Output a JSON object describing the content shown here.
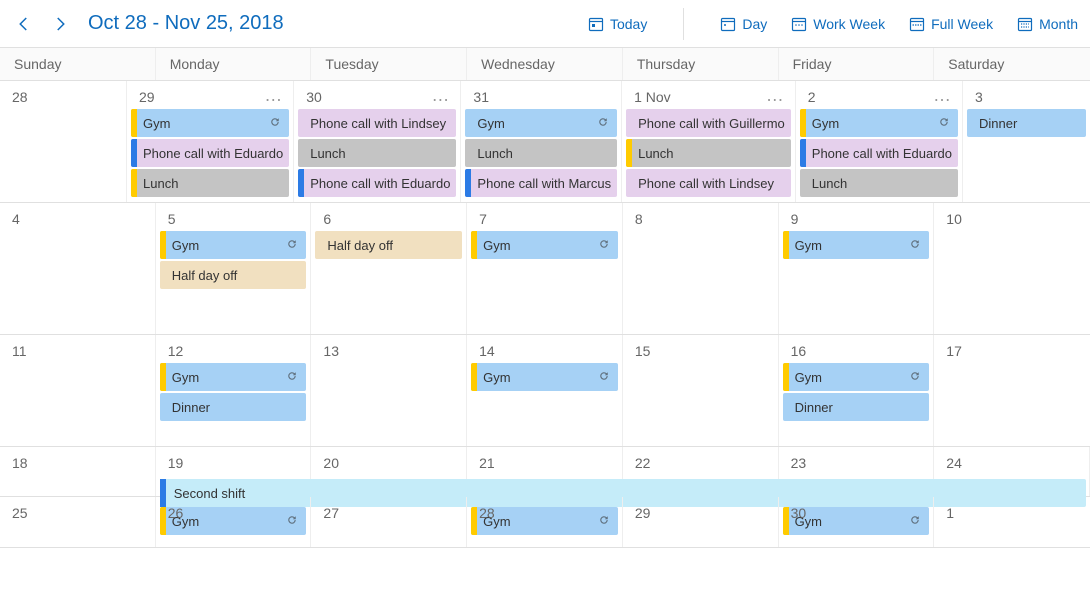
{
  "header": {
    "title": "Oct 28 - Nov 25, 2018",
    "today": "Today",
    "views": {
      "day": "Day",
      "workweek": "Work Week",
      "fullweek": "Full Week",
      "month": "Month"
    }
  },
  "dayNames": [
    "Sunday",
    "Monday",
    "Tuesday",
    "Wednesday",
    "Thursday",
    "Friday",
    "Saturday"
  ],
  "weeks": [
    {
      "days": [
        {
          "num": "28",
          "more": false,
          "events": []
        },
        {
          "num": "29",
          "more": true,
          "events": [
            {
              "label": "Gym",
              "bg": "bg-blue",
              "stripe": "st-yellow",
              "recur": true
            },
            {
              "label": "Phone call with Eduardo",
              "bg": "bg-purple",
              "stripe": "st-blue",
              "recur": false
            },
            {
              "label": "Lunch",
              "bg": "bg-gray",
              "stripe": "st-yellow",
              "recur": false
            }
          ]
        },
        {
          "num": "30",
          "more": true,
          "events": [
            {
              "label": "Phone call with Lindsey",
              "bg": "bg-purple",
              "stripe": "st-none",
              "recur": false
            },
            {
              "label": "Lunch",
              "bg": "bg-gray",
              "stripe": "st-none",
              "recur": false
            },
            {
              "label": "Phone call with Eduardo",
              "bg": "bg-purple",
              "stripe": "st-blue",
              "recur": false
            }
          ]
        },
        {
          "num": "31",
          "more": false,
          "events": [
            {
              "label": "Gym",
              "bg": "bg-blue",
              "stripe": "st-none",
              "recur": true
            },
            {
              "label": "Lunch",
              "bg": "bg-gray",
              "stripe": "st-none",
              "recur": false
            },
            {
              "label": "Phone call with Marcus",
              "bg": "bg-purple",
              "stripe": "st-blue",
              "recur": false
            }
          ]
        },
        {
          "num": "1 Nov",
          "more": true,
          "events": [
            {
              "label": "Phone call with Guillermo",
              "bg": "bg-purple",
              "stripe": "st-none",
              "recur": false
            },
            {
              "label": "Lunch",
              "bg": "bg-gray",
              "stripe": "st-yellow",
              "recur": false
            },
            {
              "label": "Phone call with Lindsey",
              "bg": "bg-purple",
              "stripe": "st-none",
              "recur": false
            }
          ]
        },
        {
          "num": "2",
          "more": true,
          "events": [
            {
              "label": "Gym",
              "bg": "bg-blue",
              "stripe": "st-yellow",
              "recur": true
            },
            {
              "label": "Phone call with Eduardo",
              "bg": "bg-purple",
              "stripe": "st-blue",
              "recur": false
            },
            {
              "label": "Lunch",
              "bg": "bg-gray",
              "stripe": "st-none",
              "recur": false
            }
          ]
        },
        {
          "num": "3",
          "more": false,
          "events": [
            {
              "label": "Dinner",
              "bg": "bg-blue",
              "stripe": "st-none",
              "recur": false
            }
          ]
        }
      ]
    },
    {
      "days": [
        {
          "num": "4",
          "more": false,
          "events": []
        },
        {
          "num": "5",
          "more": false,
          "events": [
            {
              "label": "Gym",
              "bg": "bg-blue",
              "stripe": "st-yellow",
              "recur": true
            },
            {
              "label": "Half day off",
              "bg": "bg-tan",
              "stripe": "st-none",
              "recur": false
            }
          ]
        },
        {
          "num": "6",
          "more": false,
          "events": [
            {
              "label": "Half day off",
              "bg": "bg-tan",
              "stripe": "st-none",
              "recur": false
            }
          ]
        },
        {
          "num": "7",
          "more": false,
          "events": [
            {
              "label": "Gym",
              "bg": "bg-blue",
              "stripe": "st-yellow",
              "recur": true
            }
          ]
        },
        {
          "num": "8",
          "more": false,
          "events": []
        },
        {
          "num": "9",
          "more": false,
          "events": [
            {
              "label": "Gym",
              "bg": "bg-blue",
              "stripe": "st-yellow",
              "recur": true
            }
          ]
        },
        {
          "num": "10",
          "more": false,
          "events": []
        }
      ]
    },
    {
      "days": [
        {
          "num": "11",
          "more": false,
          "events": []
        },
        {
          "num": "12",
          "more": false,
          "events": [
            {
              "label": "Gym",
              "bg": "bg-blue",
              "stripe": "st-yellow",
              "recur": true
            },
            {
              "label": "Dinner",
              "bg": "bg-blue",
              "stripe": "st-none",
              "recur": false
            }
          ]
        },
        {
          "num": "13",
          "more": false,
          "events": []
        },
        {
          "num": "14",
          "more": false,
          "events": [
            {
              "label": "Gym",
              "bg": "bg-blue",
              "stripe": "st-yellow",
              "recur": true
            }
          ]
        },
        {
          "num": "15",
          "more": false,
          "events": []
        },
        {
          "num": "16",
          "more": false,
          "events": [
            {
              "label": "Gym",
              "bg": "bg-blue",
              "stripe": "st-yellow",
              "recur": true
            },
            {
              "label": "Dinner",
              "bg": "bg-blue",
              "stripe": "st-none",
              "recur": false
            }
          ]
        },
        {
          "num": "17",
          "more": false,
          "events": []
        }
      ]
    },
    {
      "span": {
        "label": "Second shift"
      },
      "days": [
        {
          "num": "18",
          "more": false,
          "events": []
        },
        {
          "num": "19",
          "more": false,
          "spangap": true,
          "events": [
            {
              "label": "Gym",
              "bg": "bg-blue",
              "stripe": "st-yellow",
              "recur": true
            }
          ]
        },
        {
          "num": "20",
          "more": false,
          "spangap": true,
          "events": []
        },
        {
          "num": "21",
          "more": false,
          "spangap": true,
          "events": [
            {
              "label": "Gym",
              "bg": "bg-blue",
              "stripe": "st-yellow",
              "recur": true
            }
          ]
        },
        {
          "num": "22",
          "more": false,
          "spangap": true,
          "events": []
        },
        {
          "num": "23",
          "more": false,
          "spangap": true,
          "events": [
            {
              "label": "Gym",
              "bg": "bg-blue",
              "stripe": "st-yellow",
              "recur": true
            }
          ]
        },
        {
          "num": "24",
          "more": false,
          "spangap": true,
          "events": []
        }
      ]
    },
    {
      "condensed": true,
      "days": [
        {
          "num": "25",
          "more": false,
          "events": []
        },
        {
          "num": "26",
          "more": false,
          "events": []
        },
        {
          "num": "27",
          "more": false,
          "events": []
        },
        {
          "num": "28",
          "more": false,
          "events": []
        },
        {
          "num": "29",
          "more": false,
          "events": []
        },
        {
          "num": "30",
          "more": false,
          "events": []
        },
        {
          "num": "1",
          "more": false,
          "events": []
        }
      ]
    }
  ]
}
